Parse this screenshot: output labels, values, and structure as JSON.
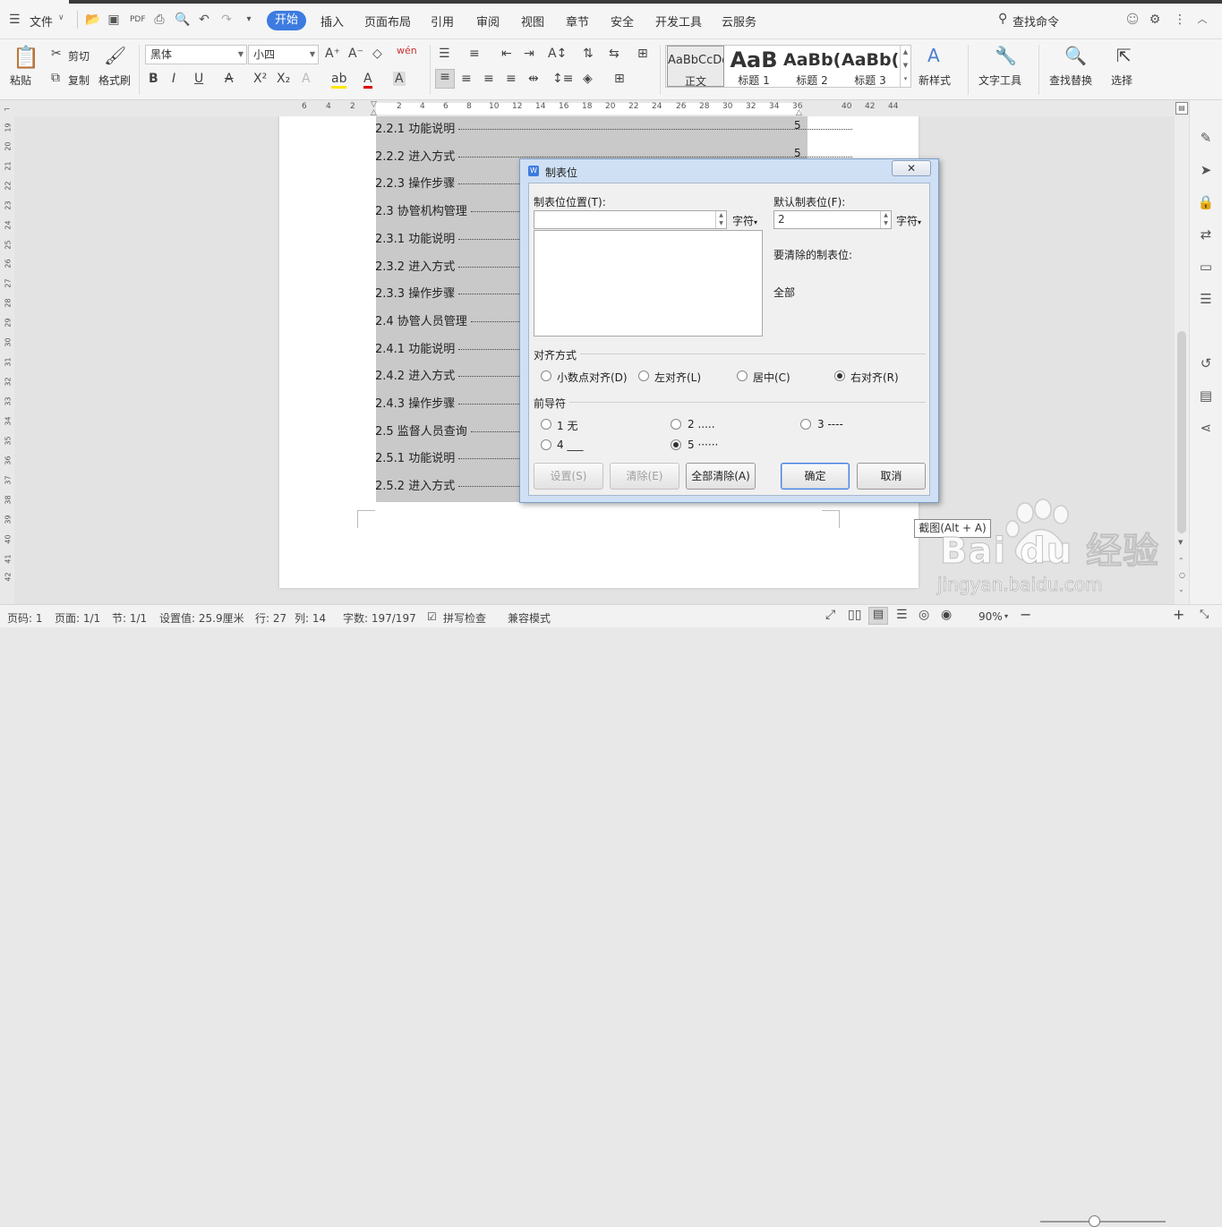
{
  "menubar": {
    "file_label": "文件",
    "tabs": [
      "开始",
      "插入",
      "页面布局",
      "引用",
      "审阅",
      "视图",
      "章节",
      "安全",
      "开发工具",
      "云服务"
    ],
    "active_tab": "开始",
    "search_label": "查找命令"
  },
  "ribbon": {
    "paste_label": "粘贴",
    "cut_label": "剪切",
    "copy_label": "复制",
    "format_painter_label": "格式刷",
    "font_name": "黑体",
    "font_size": "小四",
    "styles": [
      {
        "preview": "AaBbCcDd",
        "label": "正文"
      },
      {
        "preview": "AaB",
        "label": "标题 1"
      },
      {
        "preview": "AaBb(",
        "label": "标题 2"
      },
      {
        "preview": "AaBb(",
        "label": "标题 3"
      }
    ],
    "new_style_label": "新样式",
    "text_tools_label": "文字工具",
    "find_replace_label": "查找替换",
    "select_label": "选择"
  },
  "ruler": {
    "numbers": [
      "6",
      "4",
      "2",
      "2",
      "4",
      "6",
      "8",
      "10",
      "12",
      "14",
      "16",
      "18",
      "20",
      "22",
      "24",
      "26",
      "28",
      "30",
      "32",
      "34",
      "36",
      "40",
      "42",
      "44"
    ],
    "vertical_numbers": [
      "19",
      "20",
      "21",
      "22",
      "23",
      "24",
      "25",
      "26",
      "27",
      "28",
      "29",
      "30",
      "31",
      "32",
      "33",
      "34",
      "35",
      "36",
      "37",
      "38",
      "39",
      "40",
      "41",
      "42"
    ]
  },
  "document": {
    "toc_lines": [
      {
        "text": "2.2.1 功能说明",
        "page": "5"
      },
      {
        "text": "2.2.2 进入方式",
        "page": "5"
      },
      {
        "text": "2.2.3 操作步骤",
        "page": ""
      },
      {
        "text": "2.3 协管机构管理",
        "page": ""
      },
      {
        "text": "2.3.1 功能说明",
        "page": ""
      },
      {
        "text": "2.3.2 进入方式",
        "page": ""
      },
      {
        "text": "2.3.3 操作步骤",
        "page": ""
      },
      {
        "text": "2.4 协管人员管理",
        "page": ""
      },
      {
        "text": "2.4.1 功能说明",
        "page": ""
      },
      {
        "text": "2.4.2 进入方式",
        "page": ""
      },
      {
        "text": "2.4.3 操作步骤",
        "page": ""
      },
      {
        "text": "2.5 监督人员查询",
        "page": ""
      },
      {
        "text": "2.5.1 功能说明",
        "page": ""
      },
      {
        "text": "2.5.2 进入方式",
        "page": ""
      }
    ]
  },
  "dialog": {
    "title": "制表位",
    "tab_position_label": "制表位位置(T):",
    "tab_position_value": "",
    "unit_label": "字符",
    "default_tab_label": "默认制表位(F):",
    "default_tab_value": "2",
    "default_unit_label": "字符",
    "to_clear_label": "要清除的制表位:",
    "clear_value": "全部",
    "alignment_group_label": "对齐方式",
    "alignment_options": [
      {
        "label": "小数点对齐(D)",
        "checked": false
      },
      {
        "label": "左对齐(L)",
        "checked": false
      },
      {
        "label": "居中(C)",
        "checked": false
      },
      {
        "label": "右对齐(R)",
        "checked": true
      }
    ],
    "leader_group_label": "前导符",
    "leader_options": [
      {
        "label": "1 无",
        "checked": false
      },
      {
        "label": "2 .....",
        "checked": false
      },
      {
        "label": "3 ----",
        "checked": false
      },
      {
        "label": "4 ___",
        "checked": false
      },
      {
        "label": "5 ······",
        "checked": true
      }
    ],
    "set_button": "设置(S)",
    "clear_button": "清除(E)",
    "clear_all_button": "全部清除(A)",
    "ok_button": "确定",
    "cancel_button": "取消"
  },
  "tooltip": "截图(Alt + A)",
  "status": {
    "page_code": "页码: 1",
    "pages": "页面: 1/1",
    "section": "节: 1/1",
    "setting": "设置值: 25.9厘米",
    "row": "行: 27",
    "col": "列: 14",
    "words": "字数: 197/197",
    "spell_check": "拼写检查",
    "compat_mode": "兼容模式",
    "zoom": "90%"
  },
  "watermark": {
    "brand": "Bai du 经验",
    "url": "jingyan.baidu.com"
  },
  "colors": {
    "accent": "#3d7be0",
    "selection": "#c9c9c9",
    "dialog_frame": "#cfe0f4"
  }
}
